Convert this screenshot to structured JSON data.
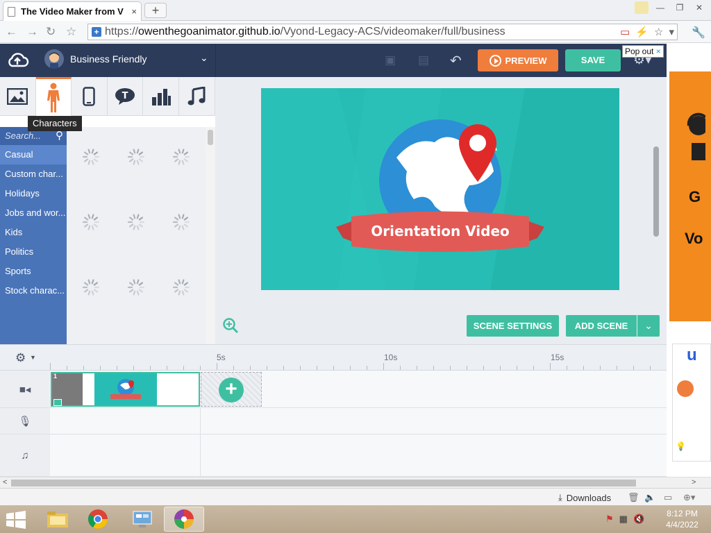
{
  "browser": {
    "tab_title": "The Video Maker from V",
    "tab_close": "×",
    "new_tab": "+",
    "url_scheme": "https://",
    "url_host": "owenthegoanimator.github.io",
    "url_path": "/Vyond-Legacy-ACS/videomaker/full/business"
  },
  "app": {
    "theme_name": "Business Friendly",
    "preview_label": "PREVIEW",
    "save_label": "SAVE",
    "popout_label": "Pop out",
    "popout_close": "×",
    "tooltip": "Characters",
    "search_placeholder": "Search...",
    "categories": [
      "Casual",
      "Custom char...",
      "Holidays",
      "Jobs and wor...",
      "Kids",
      "Politics",
      "Sports",
      "Stock charac..."
    ],
    "scene_title": "Orientation Video",
    "scene_settings_label": "SCENE SETTINGS",
    "add_scene_label": "ADD SCENE",
    "timeline": {
      "marks": [
        "5s",
        "10s",
        "15s"
      ],
      "scene_number": "1"
    }
  },
  "statusbar": {
    "downloads_label": "Downloads"
  },
  "taskbar": {
    "time": "8:12 PM",
    "date": "4/4/2022"
  },
  "colors": {
    "accent_orange": "#ef7d3c",
    "accent_green": "#3fbfa1",
    "navy": "#2c3b5a",
    "category_blue": "#4a74b8",
    "canvas_teal": "#27bdb4"
  }
}
